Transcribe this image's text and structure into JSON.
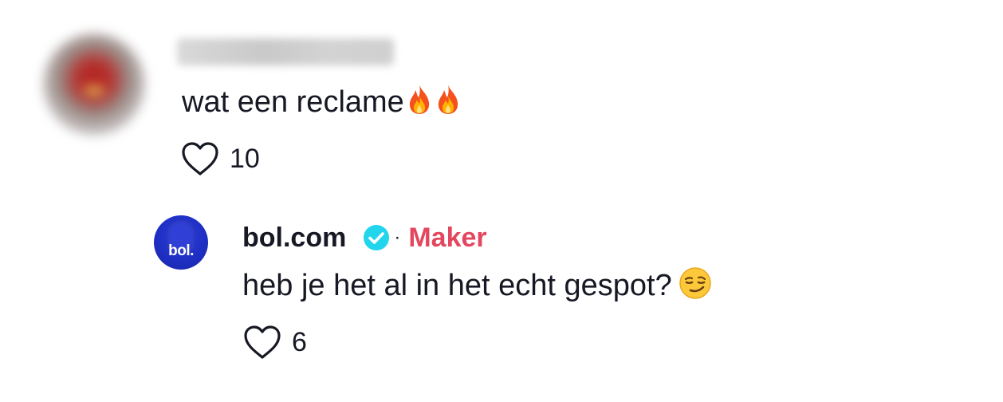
{
  "comment": {
    "username": "user2829479",
    "text": "wat een reclame",
    "emoji": [
      "fire-icon",
      "fire-icon"
    ],
    "likes": "10"
  },
  "reply": {
    "username": "bol.com",
    "avatar_text": "bol.",
    "verified": true,
    "separator": "·",
    "badge": "Maker",
    "text": "heb je het al in het echt gespot?",
    "emoji": "smirking-face-icon",
    "likes": "6"
  },
  "colors": {
    "text": "#161823",
    "maker_badge": "#e3475f",
    "verified_badge": "#20d5ec",
    "bol_blue": "#1f2fc4"
  }
}
